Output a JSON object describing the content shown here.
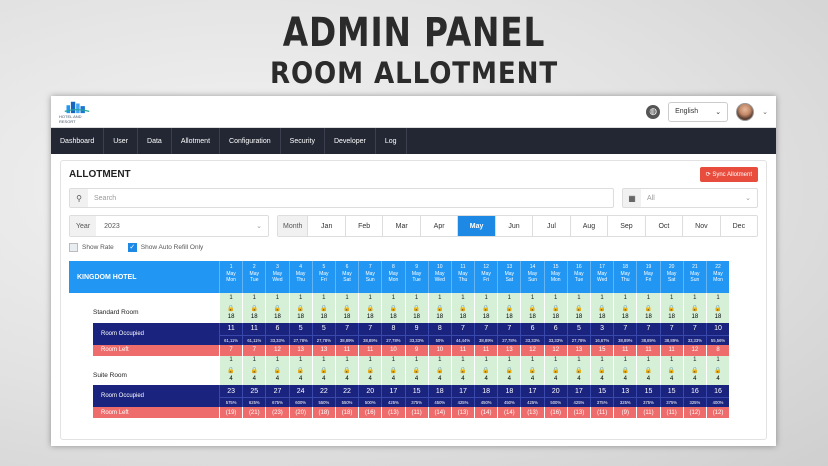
{
  "banner": {
    "title": "ADMIN PANEL",
    "subtitle": "ROOM ALLOTMENT"
  },
  "topbar": {
    "logo_text": "HOTEL AND RESORT",
    "language": "English"
  },
  "nav": [
    "Dashboard",
    "User",
    "Data",
    "Allotment",
    "Configuration",
    "Security",
    "Developer",
    "Log"
  ],
  "allotment": {
    "title": "ALLOTMENT",
    "sync_label": "Sync Allotment",
    "search_placeholder": "Search",
    "hotel_select": "All",
    "year_label": "Year",
    "year_value": "2023",
    "month_label": "Month",
    "months": [
      "Jan",
      "Feb",
      "Mar",
      "Apr",
      "May",
      "Jun",
      "Jul",
      "Aug",
      "Sep",
      "Oct",
      "Nov",
      "Dec"
    ],
    "active_month": "May",
    "show_rate": "Show Rate",
    "show_auto_refill": "Show Auto Refill Only"
  },
  "grid": {
    "hotel": "KINGDOM HOTEL",
    "days": [
      {
        "d": "1",
        "m": "May",
        "w": "Mon"
      },
      {
        "d": "2",
        "m": "May",
        "w": "Tue"
      },
      {
        "d": "3",
        "m": "May",
        "w": "Wed"
      },
      {
        "d": "4",
        "m": "May",
        "w": "Thu"
      },
      {
        "d": "5",
        "m": "May",
        "w": "Fri"
      },
      {
        "d": "6",
        "m": "May",
        "w": "Sat"
      },
      {
        "d": "7",
        "m": "May",
        "w": "Sun"
      },
      {
        "d": "8",
        "m": "May",
        "w": "Mon"
      },
      {
        "d": "9",
        "m": "May",
        "w": "Tue"
      },
      {
        "d": "10",
        "m": "May",
        "w": "Wed"
      },
      {
        "d": "11",
        "m": "May",
        "w": "Thu"
      },
      {
        "d": "12",
        "m": "May",
        "w": "Fri"
      },
      {
        "d": "13",
        "m": "May",
        "w": "Sat"
      },
      {
        "d": "14",
        "m": "May",
        "w": "Sun"
      },
      {
        "d": "15",
        "m": "May",
        "w": "Mon"
      },
      {
        "d": "16",
        "m": "May",
        "w": "Tue"
      },
      {
        "d": "17",
        "m": "May",
        "w": "Wed"
      },
      {
        "d": "18",
        "m": "May",
        "w": "Thu"
      },
      {
        "d": "19",
        "m": "May",
        "w": "Fri"
      },
      {
        "d": "20",
        "m": "May",
        "w": "Sat"
      },
      {
        "d": "21",
        "m": "May",
        "w": "Sun"
      },
      {
        "d": "22",
        "m": "May",
        "w": "Mon"
      }
    ],
    "rooms": [
      {
        "name": "Standard Room",
        "top": [
          "1",
          "1",
          "1",
          "1",
          "1",
          "1",
          "1",
          "1",
          "1",
          "1",
          "1",
          "1",
          "1",
          "1",
          "1",
          "1",
          "1",
          "1",
          "1",
          "1",
          "1",
          "1"
        ],
        "allot": [
          "18",
          "18",
          "18",
          "18",
          "18",
          "18",
          "18",
          "18",
          "18",
          "18",
          "18",
          "18",
          "18",
          "18",
          "18",
          "18",
          "18",
          "18",
          "18",
          "18",
          "18",
          "18"
        ],
        "occ_label": "Room Occupied",
        "occ": [
          "11",
          "11",
          "6",
          "5",
          "5",
          "7",
          "7",
          "8",
          "9",
          "8",
          "7",
          "7",
          "7",
          "6",
          "6",
          "5",
          "3",
          "7",
          "7",
          "7",
          "7",
          "10"
        ],
        "pct": [
          "61,11%",
          "61,11%",
          "33,33%",
          "27,78%",
          "27,78%",
          "38,89%",
          "38,89%",
          "27,78%",
          "33,33%",
          "50%",
          "44,44%",
          "38,89%",
          "27,78%",
          "33,33%",
          "33,33%",
          "27,78%",
          "16,67%",
          "38,89%",
          "38,89%",
          "38,89%",
          "33,33%",
          "55,56%"
        ],
        "left_label": "Room Left",
        "left": [
          "7",
          "7",
          "12",
          "13",
          "13",
          "11",
          "11",
          "10",
          "9",
          "10",
          "11",
          "11",
          "13",
          "12",
          "12",
          "13",
          "15",
          "11",
          "11",
          "11",
          "12",
          "8"
        ]
      },
      {
        "name": "Suite Room",
        "top": [
          "1",
          "1",
          "1",
          "1",
          "1",
          "1",
          "1",
          "1",
          "1",
          "1",
          "1",
          "1",
          "1",
          "1",
          "1",
          "1",
          "1",
          "1",
          "1",
          "1",
          "1",
          "1"
        ],
        "allot": [
          "4",
          "4",
          "4",
          "4",
          "4",
          "4",
          "4",
          "4",
          "4",
          "4",
          "4",
          "4",
          "4",
          "4",
          "4",
          "4",
          "4",
          "4",
          "4",
          "4",
          "4",
          "4"
        ],
        "occ_label": "Room Occupied",
        "occ": [
          "23",
          "25",
          "27",
          "24",
          "22",
          "22",
          "20",
          "17",
          "15",
          "18",
          "17",
          "18",
          "18",
          "17",
          "20",
          "17",
          "15",
          "13",
          "15",
          "15",
          "16",
          "16"
        ],
        "pct": [
          "575%",
          "625%",
          "675%",
          "600%",
          "550%",
          "550%",
          "500%",
          "425%",
          "375%",
          "450%",
          "425%",
          "450%",
          "450%",
          "425%",
          "500%",
          "425%",
          "375%",
          "325%",
          "375%",
          "375%",
          "325%",
          "400%"
        ],
        "left_label": "Room Left",
        "left": [
          "(19)",
          "(21)",
          "(23)",
          "(20)",
          "(18)",
          "(18)",
          "(16)",
          "(13)",
          "(11)",
          "(14)",
          "(13)",
          "(14)",
          "(14)",
          "(13)",
          "(16)",
          "(13)",
          "(11)",
          "(9)",
          "(11)",
          "(11)",
          "(12)",
          "(12)"
        ]
      }
    ]
  }
}
